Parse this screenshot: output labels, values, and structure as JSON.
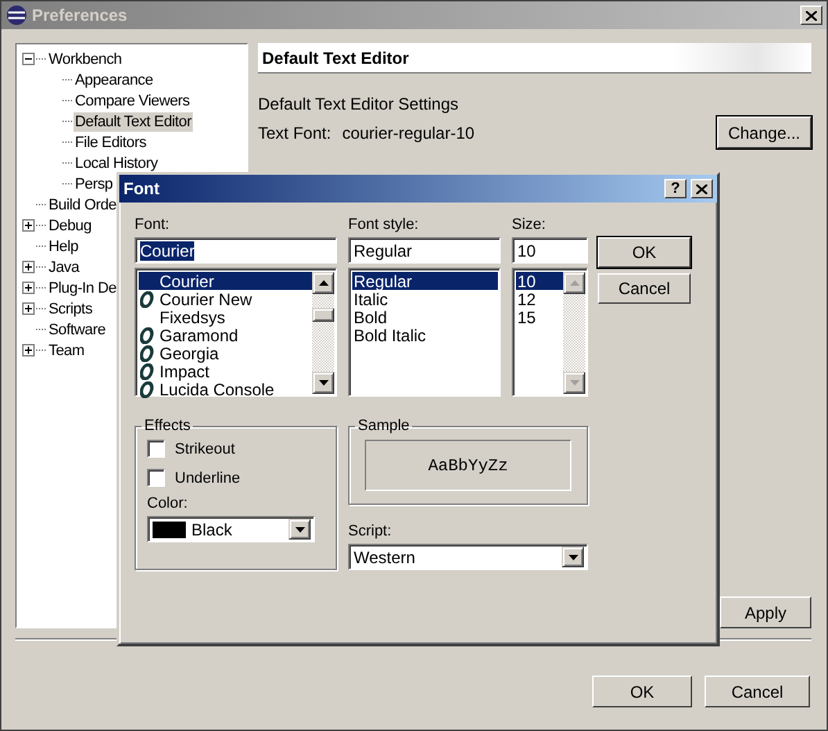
{
  "window": {
    "title": "Preferences"
  },
  "tree": [
    {
      "label": "Workbench",
      "expanded": true,
      "selected": false,
      "children": [
        {
          "label": "Appearance",
          "selected": false
        },
        {
          "label": "Compare Viewers",
          "selected": false
        },
        {
          "label": "Default Text Editor",
          "selected": true
        },
        {
          "label": "File Editors",
          "selected": false
        },
        {
          "label": "Local History",
          "selected": false
        },
        {
          "label": "Persp",
          "selected": false
        }
      ]
    },
    {
      "label": "Build Orde",
      "selected": false
    },
    {
      "label": "Debug",
      "expanded": false,
      "selected": false
    },
    {
      "label": "Help",
      "selected": false
    },
    {
      "label": "Java",
      "expanded": false,
      "selected": false
    },
    {
      "label": "Plug-In De",
      "expanded": false,
      "selected": false
    },
    {
      "label": "Scripts",
      "expanded": false,
      "selected": false
    },
    {
      "label": "Software",
      "selected": false
    },
    {
      "label": "Team",
      "expanded": false,
      "selected": false
    }
  ],
  "page": {
    "header": "Default Text Editor",
    "settings_label": "Default Text Editor Settings",
    "text_font_label": "Text Font:",
    "text_font_value": "courier-regular-10",
    "change_button": "Change...",
    "apply_button": "Apply"
  },
  "buttons": [
    {
      "label": "OK"
    },
    {
      "label": "Cancel"
    }
  ],
  "font_dialog": {
    "title": "Font",
    "help": "?",
    "font": {
      "label": "Font:",
      "value": "Courier",
      "items": [
        {
          "name": "Courier",
          "kind": "bitmap",
          "selected": true
        },
        {
          "name": "Courier New",
          "kind": "opentype",
          "selected": false
        },
        {
          "name": "Fixedsys",
          "kind": "bitmap",
          "selected": false
        },
        {
          "name": "Garamond",
          "kind": "opentype",
          "selected": false
        },
        {
          "name": "Georgia",
          "kind": "opentype",
          "selected": false
        },
        {
          "name": "Impact",
          "kind": "opentype",
          "selected": false
        },
        {
          "name": "Lucida Console",
          "kind": "opentype",
          "selected": false
        }
      ]
    },
    "style": {
      "label": "Font style:",
      "value": "Regular",
      "items": [
        {
          "name": "Regular",
          "selected": true
        },
        {
          "name": "Italic",
          "selected": false
        },
        {
          "name": "Bold",
          "selected": false
        },
        {
          "name": "Bold Italic",
          "selected": false
        }
      ]
    },
    "size": {
      "label": "Size:",
      "value": "10",
      "items": [
        {
          "name": "10",
          "selected": true
        },
        {
          "name": "12",
          "selected": false
        },
        {
          "name": "15",
          "selected": false
        }
      ]
    },
    "buttons": [
      {
        "label": "OK",
        "default": true
      },
      {
        "label": "Cancel",
        "default": false
      }
    ],
    "effects": {
      "title": "Effects",
      "options": [
        {
          "label": "Strikeout",
          "checked": false
        },
        {
          "label": "Underline",
          "checked": false
        }
      ],
      "color_label": "Color:",
      "color": {
        "name": "Black",
        "color": "#000000"
      }
    },
    "sample": {
      "title": "Sample",
      "text": "AaBbYyZz"
    },
    "script": {
      "label": "Script:",
      "value": "Western"
    }
  }
}
